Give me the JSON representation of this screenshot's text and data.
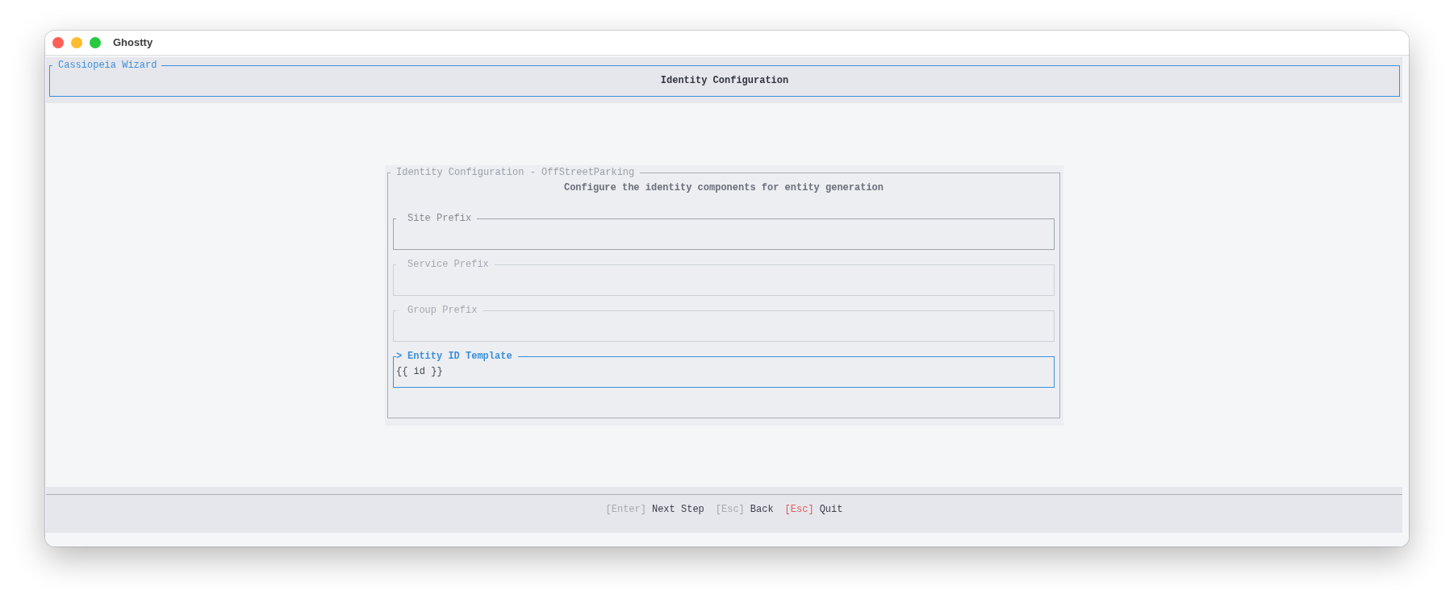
{
  "window": {
    "title": "Ghostty"
  },
  "header": {
    "app_title": "Cassiopeia Wizard",
    "page_title": "Identity Configuration"
  },
  "dialog": {
    "title": "Identity Configuration - OffStreetParking",
    "subtitle": "Configure the identity components for entity generation",
    "focus_marker": ">",
    "fields": [
      {
        "label": "Site Prefix",
        "focused": false,
        "disabled": false
      },
      {
        "label": "Service Prefix",
        "focused": false,
        "disabled": true
      },
      {
        "label": "Group Prefix",
        "focused": false,
        "disabled": true
      },
      {
        "label": "Entity ID Template",
        "focused": true,
        "disabled": false,
        "value": "{{ id }}"
      }
    ]
  },
  "footer": {
    "hints": [
      {
        "key": "[Enter]",
        "action": "Next Step",
        "color": "#a6a9b1"
      },
      {
        "key": "[Esc]",
        "action": "Back",
        "color": "#a6a9b1"
      },
      {
        "key": "[Esc]",
        "action": "Quit",
        "color": "#e05a5a"
      }
    ]
  }
}
